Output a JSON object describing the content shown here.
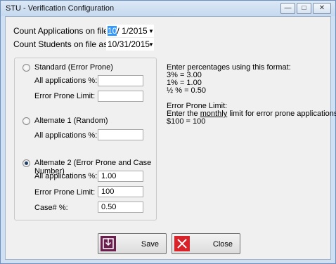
{
  "window": {
    "title": "STU - Verification Configuration",
    "buttons": {
      "minimize": "—",
      "maximize": "□",
      "close": "✕"
    }
  },
  "dates": {
    "applications_label": "Count Applications on file as of:",
    "applications_value_month": "10",
    "applications_value_rest": "/ 1/2015",
    "students_label": "Count Students on file as of:",
    "students_value": "10/31/2015"
  },
  "options": {
    "standard": {
      "label": "Standard (Error Prone)",
      "checked": false,
      "all_apps_label": "All applications %:",
      "all_apps_value": "",
      "error_prone_label": "Error Prone Limit:",
      "error_prone_value": ""
    },
    "alt1": {
      "label": "Altemate 1 (Random)",
      "checked": false,
      "all_apps_label": "All applications %:",
      "all_apps_value": ""
    },
    "alt2": {
      "label": "Altemate 2 (Error Prone and Case Number)",
      "checked": true,
      "all_apps_label": "All applications %:",
      "all_apps_value": "1.00",
      "error_prone_label": "Error Prone Limit:",
      "error_prone_value": "100",
      "case_label": "Case# %:",
      "case_value": "0.50"
    }
  },
  "info": {
    "line1": "Enter percentages using this format:",
    "line2": "3% = 3.00",
    "line3": "1% = 1.00",
    "line4": "½ % = 0.50",
    "line5": "Error Prone Limit:",
    "line6_a": "Enter the ",
    "line6_u": "monthly",
    "line6_b": " limit for error prone applications.",
    "line7": "$100 = 100"
  },
  "actions": {
    "save_label": "Save",
    "close_label": "Close"
  },
  "colors": {
    "save_icon": "#6b1f4f",
    "close_icon": "#d9232a",
    "accent": "#3399ff"
  }
}
